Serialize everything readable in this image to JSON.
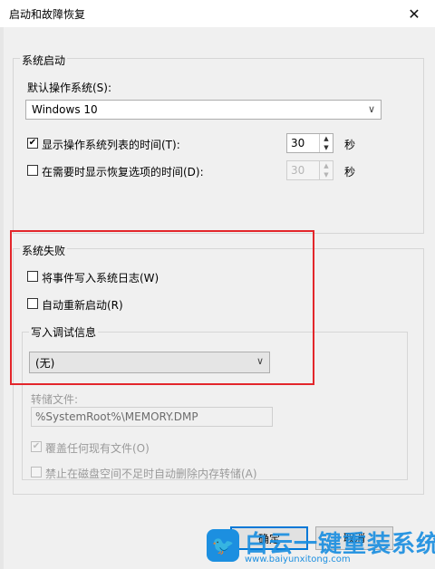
{
  "window": {
    "title": "启动和故障恢复",
    "close_glyph": "✕"
  },
  "system_startup": {
    "legend": "系统启动",
    "default_os_label": "默认操作系统(S):",
    "default_os_value": "Windows 10",
    "show_list_label": "显示操作系统列表的时间(T):",
    "show_list_checked": true,
    "show_list_seconds": "30",
    "show_list_unit": "秒",
    "show_recovery_label": "在需要时显示恢复选项的时间(D):",
    "show_recovery_checked": false,
    "show_recovery_seconds": "30",
    "show_recovery_unit": "秒"
  },
  "system_failure": {
    "legend": "系统失败",
    "write_event_label": "将事件写入系统日志(W)",
    "write_event_checked": false,
    "auto_restart_label": "自动重新启动(R)",
    "auto_restart_checked": false,
    "debug_info_legend": "写入调试信息",
    "debug_info_value": "(无)",
    "dump_file_label": "转储文件:",
    "dump_file_value": "%SystemRoot%\\MEMORY.DMP",
    "overwrite_label": "覆盖任何现有文件(O)",
    "overwrite_checked": true,
    "disable_autodelete_label": "禁止在磁盘空间不足时自动删除内存转储(A)",
    "disable_autodelete_checked": false
  },
  "buttons": {
    "ok": "确定",
    "cancel": "取消"
  },
  "watermark": {
    "text": "白云一键重装系统",
    "url": "www.baiyunxitong.com"
  },
  "icons": {
    "dropdown": "chevron-down-icon",
    "check": "checkmark-icon",
    "close": "close-icon",
    "watermark": "twitter-bird-icon"
  },
  "colors": {
    "highlight_border": "#e3262b",
    "watermark": "#1c8fe0",
    "primary_button_border": "#0078d7"
  }
}
